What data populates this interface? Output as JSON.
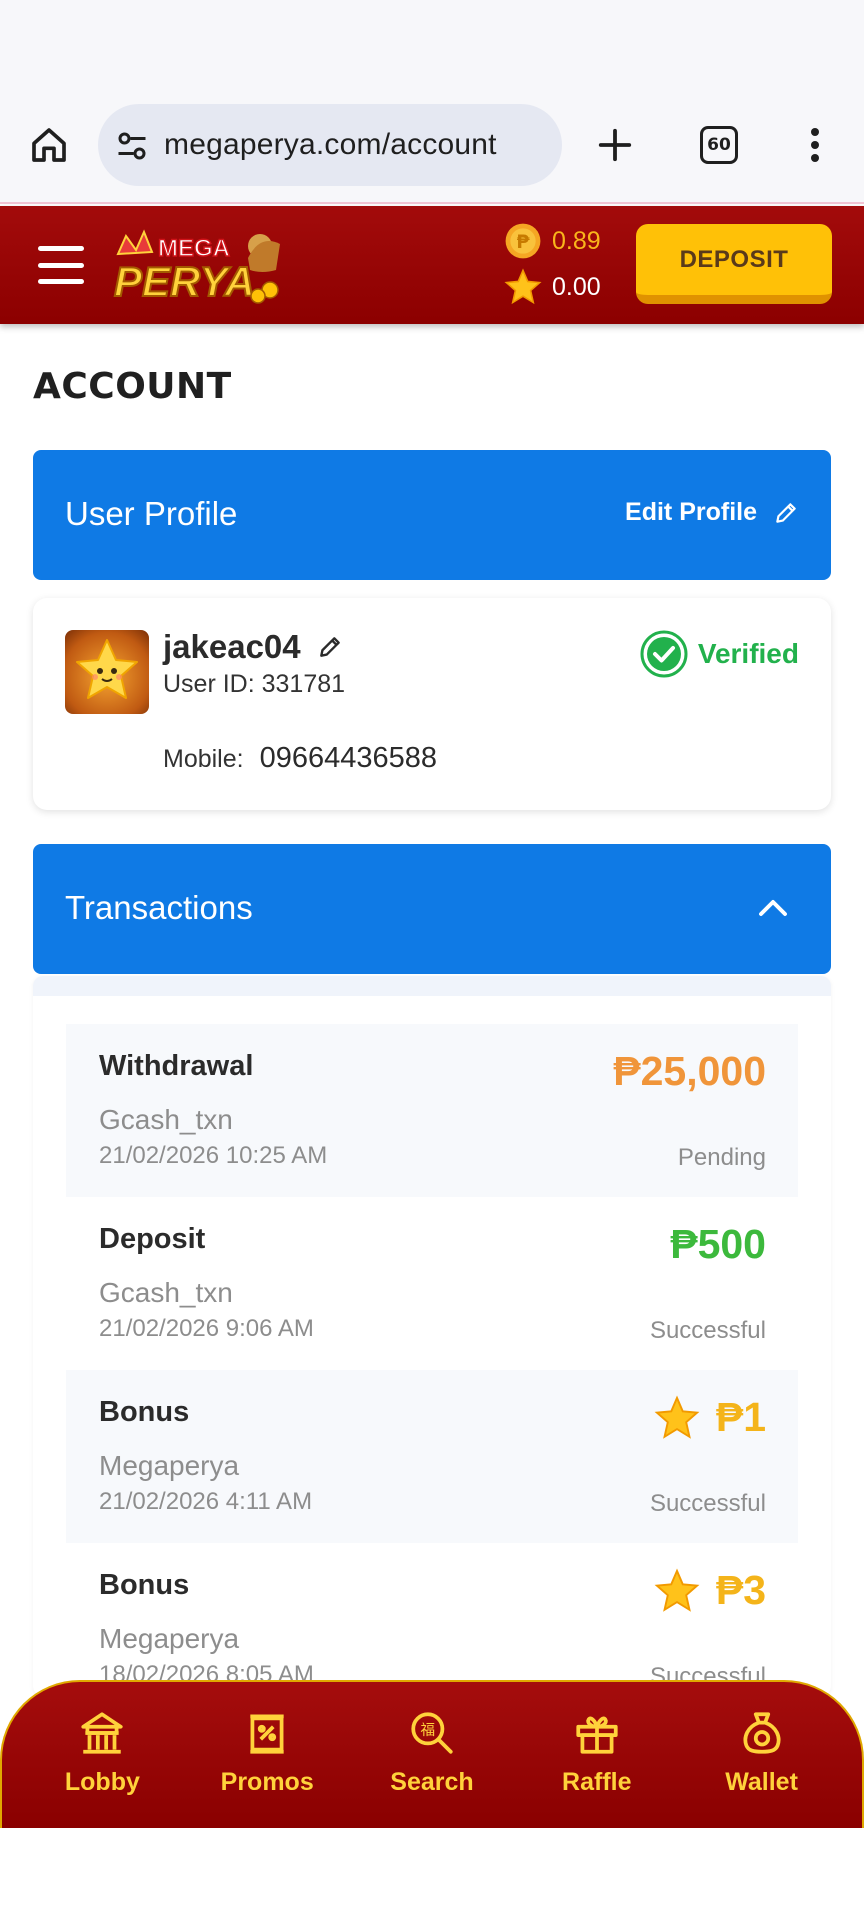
{
  "browser": {
    "url": "megaperya.com/account",
    "tab_count": "60"
  },
  "header": {
    "logo_text_top": "MEGA",
    "logo_text_main": "PERYA",
    "coin_balance": "0.89",
    "star_balance": "0.00",
    "deposit_label": "DEPOSIT"
  },
  "account": {
    "title": "ACCOUNT",
    "profile_header": "User Profile",
    "edit_profile_label": "Edit Profile",
    "username": "jakeac04",
    "user_id": "User ID: 331781",
    "verified_label": "Verified",
    "mobile_label": "Mobile:",
    "mobile_value": "09664436588"
  },
  "transactions": {
    "header": "Transactions",
    "items": [
      {
        "type": "Withdrawal",
        "source": "Gcash_txn",
        "date": "21/02/2026 10:25 AM",
        "amount": "₱25,000",
        "status": "Pending",
        "color": "#f0953a",
        "star": false
      },
      {
        "type": "Deposit",
        "source": "Gcash_txn",
        "date": "21/02/2026 9:06 AM",
        "amount": "₱500",
        "status": "Successful",
        "color": "#3cb93c",
        "star": false
      },
      {
        "type": "Bonus",
        "source": "Megaperya",
        "date": "21/02/2026 4:11 AM",
        "amount": "₱1",
        "status": "Successful",
        "color": "#f4b41a",
        "star": true
      },
      {
        "type": "Bonus",
        "source": "Megaperya",
        "date": "18/02/2026 8:05 AM",
        "amount": "₱3",
        "status": "Successful",
        "color": "#f4b41a",
        "star": true
      }
    ]
  },
  "bottom_nav": {
    "items": [
      {
        "label": "Lobby",
        "icon": "temple-icon"
      },
      {
        "label": "Promos",
        "icon": "promo-scroll-icon"
      },
      {
        "label": "Search",
        "icon": "search-icon"
      },
      {
        "label": "Raffle",
        "icon": "gift-icon"
      },
      {
        "label": "Wallet",
        "icon": "money-bag-icon"
      }
    ]
  },
  "colors": {
    "header_red": "#9a0606",
    "primary_blue": "#0f7ae5",
    "deposit_yellow": "#ffc107",
    "nav_gold": "#ffd23b",
    "verified_green": "#22b14c"
  }
}
